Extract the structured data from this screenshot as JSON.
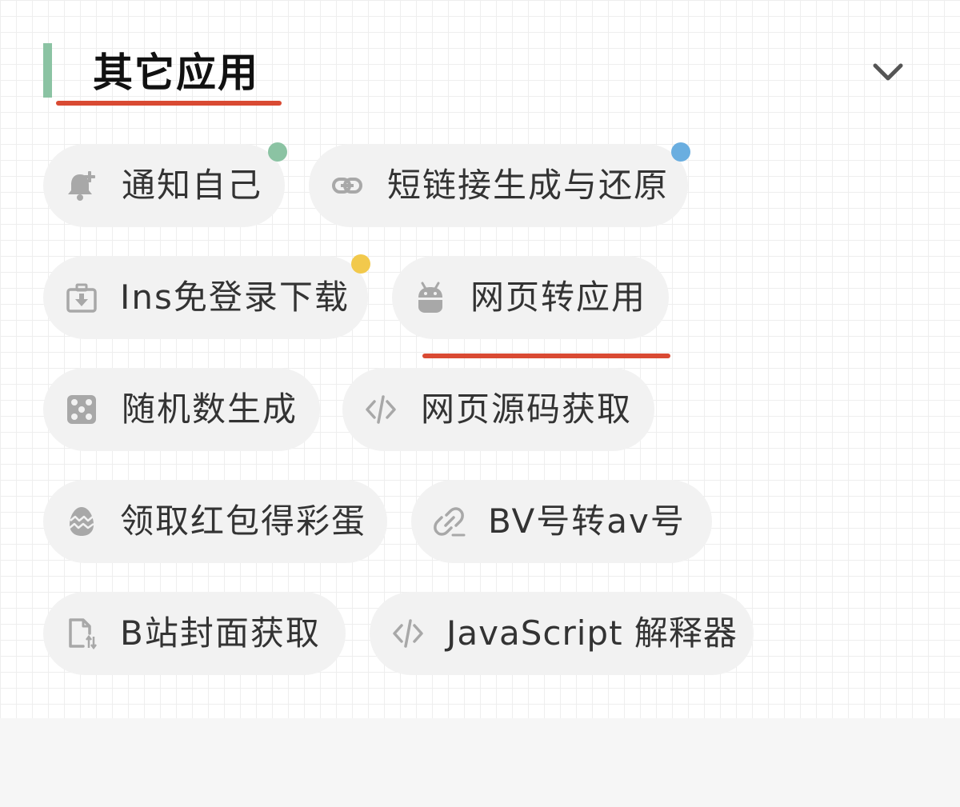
{
  "section": {
    "title": "其它应用",
    "accent_color": "#8bc3a3",
    "underline_color": "#d94a33",
    "collapse_icon": "chevron-down-icon"
  },
  "apps": [
    {
      "label": "通知自己",
      "icon": "bell-plus-icon",
      "dot_color": "#8bc3a3"
    },
    {
      "label": "短链接生成与还原",
      "icon": "link-icon",
      "dot_color": "#6aaee0"
    },
    {
      "label": "Ins免登录下载",
      "icon": "download-box-icon",
      "dot_color": "#f2c94c"
    },
    {
      "label": "网页转应用",
      "icon": "android-icon"
    },
    {
      "label": "随机数生成",
      "icon": "dice-icon"
    },
    {
      "label": "网页源码获取",
      "icon": "code-icon"
    },
    {
      "label": "领取红包得彩蛋",
      "icon": "egg-icon"
    },
    {
      "label": "BV号转av号",
      "icon": "broken-link-icon"
    },
    {
      "label": "B站封面获取",
      "icon": "file-swap-icon"
    },
    {
      "label": "JavaScript 解释器",
      "icon": "code-icon"
    }
  ]
}
